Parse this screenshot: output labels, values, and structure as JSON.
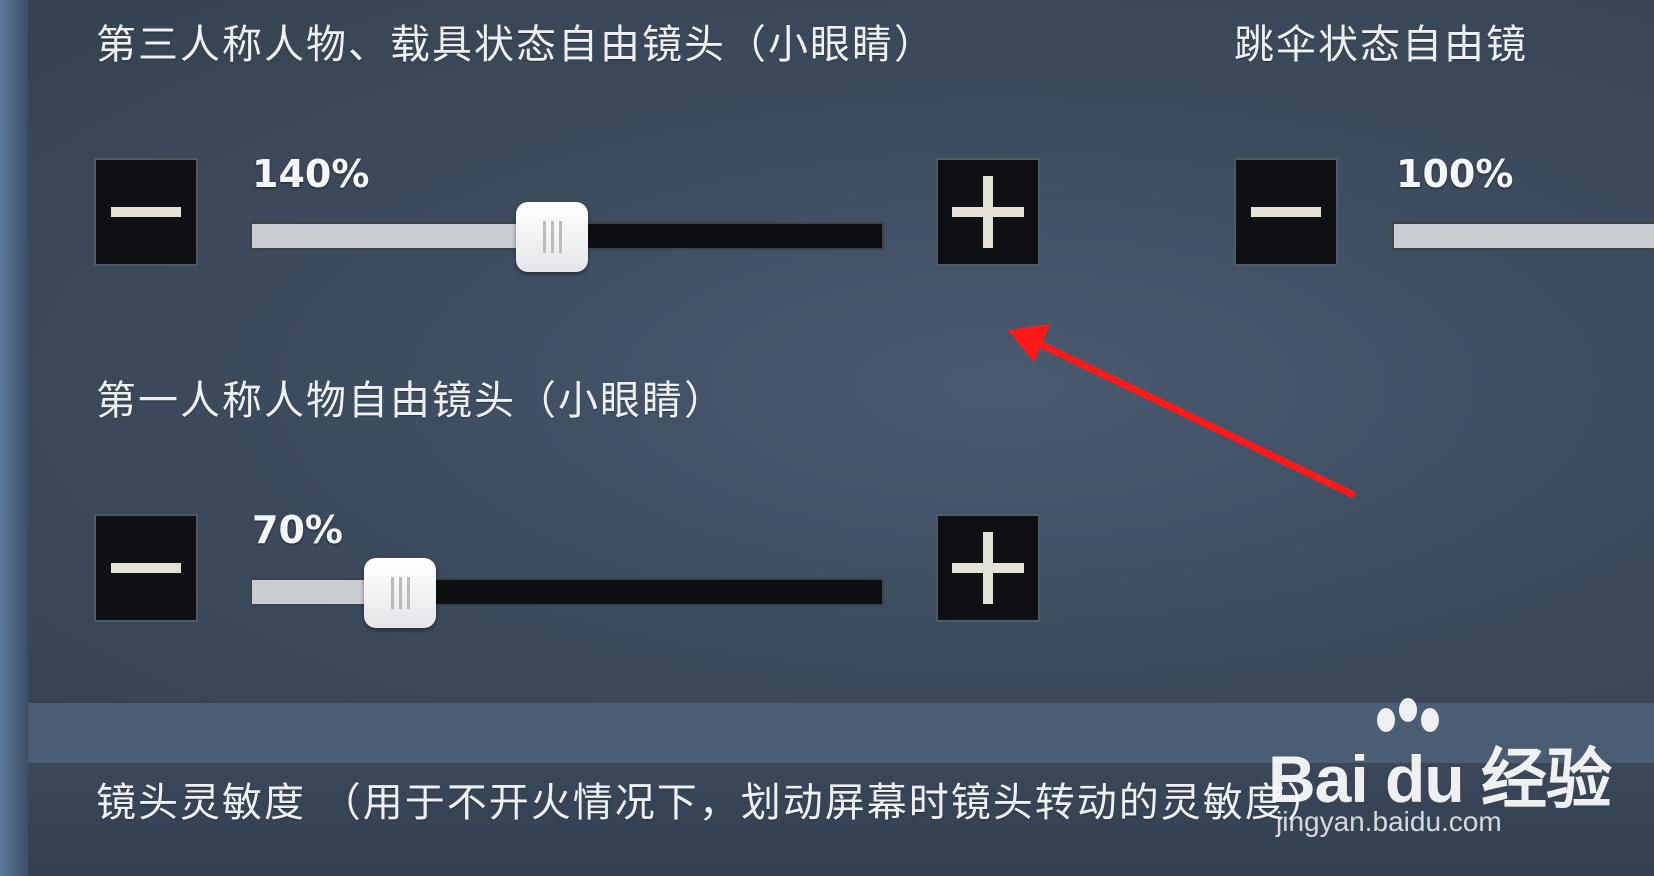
{
  "settings": {
    "third_person": {
      "label": "第三人称人物、载具状态自由镜头（小眼睛）",
      "value_text": "140%",
      "value": 140
    },
    "parachute": {
      "label": "跳伞状态自由镜",
      "value_text": "100%",
      "value": 100
    },
    "first_person": {
      "label": "第一人称人物自由镜头（小眼睛）",
      "value_text": "70%",
      "value": 70
    },
    "camera_sensitivity_header": "镜头灵敏度 （用于不开火情况下，划动屏幕时镜头转动的灵敏度）"
  },
  "slider_range": {
    "min": 0,
    "max": 300
  },
  "icons": {
    "decrease": "minus-icon",
    "increase": "plus-icon"
  },
  "annotation": {
    "arrow_color": "#ff1a1a"
  },
  "watermark": {
    "logo": "Bai du 经验",
    "url": "jingyan.baidu.com"
  }
}
